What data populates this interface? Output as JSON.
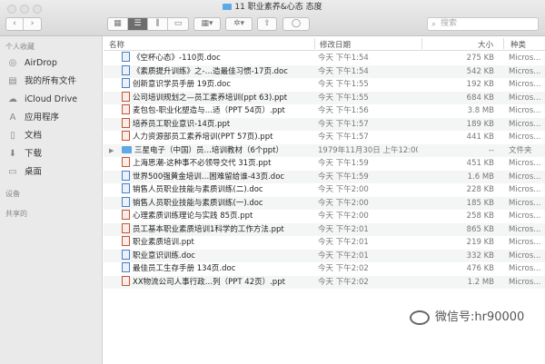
{
  "window": {
    "title": "11 职业素养&心态 态度"
  },
  "toolbar": {
    "back": "‹",
    "forward": "›",
    "view_icons": "▦",
    "view_list": "☰",
    "view_columns": "⫼",
    "view_gallery": "▭",
    "arrange": "▦▾",
    "action": "✲▾",
    "share": "⇪",
    "tag": "◯",
    "search_placeholder": "搜索"
  },
  "sidebar": {
    "favorites_label": "个人收藏",
    "items": [
      {
        "label": "AirDrop",
        "icon": "airdrop-icon",
        "glyph": "◎"
      },
      {
        "label": "我的所有文件",
        "icon": "all-files-icon",
        "glyph": "▤"
      },
      {
        "label": "iCloud Drive",
        "icon": "cloud-icon",
        "glyph": "☁"
      },
      {
        "label": "应用程序",
        "icon": "applications-icon",
        "glyph": "A"
      },
      {
        "label": "文档",
        "icon": "documents-icon",
        "glyph": "▯"
      },
      {
        "label": "下载",
        "icon": "downloads-icon",
        "glyph": "⬇"
      },
      {
        "label": "桌面",
        "icon": "desktop-icon",
        "glyph": "▭"
      }
    ],
    "devices_label": "设备",
    "shared_label": "共享的"
  },
  "columns": {
    "name": "名称",
    "date": "修改日期",
    "size": "大小",
    "kind": "种类"
  },
  "files": [
    {
      "name": "《空杯心态》-110页.doc",
      "date": "今天 下午1:54",
      "size": "275 KB",
      "kind": "Micros...",
      "type": "doc"
    },
    {
      "name": "《素质提升训练》之-…造最佳习惯-17页.doc",
      "date": "今天 下午1:54",
      "size": "542 KB",
      "kind": "Micros...",
      "type": "doc"
    },
    {
      "name": "创新意识学员手册 19页.doc",
      "date": "今天 下午1:55",
      "size": "192 KB",
      "kind": "Micros...",
      "type": "doc"
    },
    {
      "name": "公司培训规划之—员工素养培训(ppt 63).ppt",
      "date": "今天 下午1:55",
      "size": "684 KB",
      "kind": "Micros...",
      "type": "ppt"
    },
    {
      "name": "麦包包-职业化塑造与…适（PPT 54页）.ppt",
      "date": "今天 下午1:56",
      "size": "3.8 MB",
      "kind": "Micros...",
      "type": "ppt"
    },
    {
      "name": "培养员工职业意识-14页.ppt",
      "date": "今天 下午1:57",
      "size": "189 KB",
      "kind": "Micros...",
      "type": "ppt"
    },
    {
      "name": "人力资源部员工素养培训(PPT 57页).ppt",
      "date": "今天 下午1:57",
      "size": "441 KB",
      "kind": "Micros...",
      "type": "ppt"
    },
    {
      "name": "三星电子（中国）员…培训教材（6个ppt）",
      "date": "1979年11月30日 上午12:00",
      "size": "--",
      "kind": "文件夹",
      "type": "folder"
    },
    {
      "name": "上海思潮-这种事不必领导交代 31页.ppt",
      "date": "今天 下午1:59",
      "size": "451 KB",
      "kind": "Micros...",
      "type": "ppt"
    },
    {
      "name": "世界500强黄金培训…困难留给谁-43页.doc",
      "date": "今天 下午1:59",
      "size": "1.6 MB",
      "kind": "Micros...",
      "type": "doc"
    },
    {
      "name": "销售人员职业技能与素质训练(二).doc",
      "date": "今天 下午2:00",
      "size": "228 KB",
      "kind": "Micros...",
      "type": "doc"
    },
    {
      "name": "销售人员职业技能与素质训练(一).doc",
      "date": "今天 下午2:00",
      "size": "185 KB",
      "kind": "Micros...",
      "type": "doc"
    },
    {
      "name": "心理素质训练理论与实践 85页.ppt",
      "date": "今天 下午2:00",
      "size": "258 KB",
      "kind": "Micros...",
      "type": "ppt"
    },
    {
      "name": "员工基本职业素质培训1科学的工作方法.ppt",
      "date": "今天 下午2:01",
      "size": "865 KB",
      "kind": "Micros...",
      "type": "ppt"
    },
    {
      "name": "职业素质培训.ppt",
      "date": "今天 下午2:01",
      "size": "219 KB",
      "kind": "Micros...",
      "type": "ppt"
    },
    {
      "name": "职业意识训练.doc",
      "date": "今天 下午2:01",
      "size": "332 KB",
      "kind": "Micros...",
      "type": "doc"
    },
    {
      "name": "最佳员工生存手册 134页.doc",
      "date": "今天 下午2:02",
      "size": "476 KB",
      "kind": "Micros...",
      "type": "doc"
    },
    {
      "name": "XX物流公司人事行政…列（PPT 42页）.ppt",
      "date": "今天 下午2:02",
      "size": "1.2 MB",
      "kind": "Micros...",
      "type": "ppt"
    }
  ],
  "watermark": {
    "text": "微信号:hr90000",
    "icon": "wechat-icon"
  }
}
